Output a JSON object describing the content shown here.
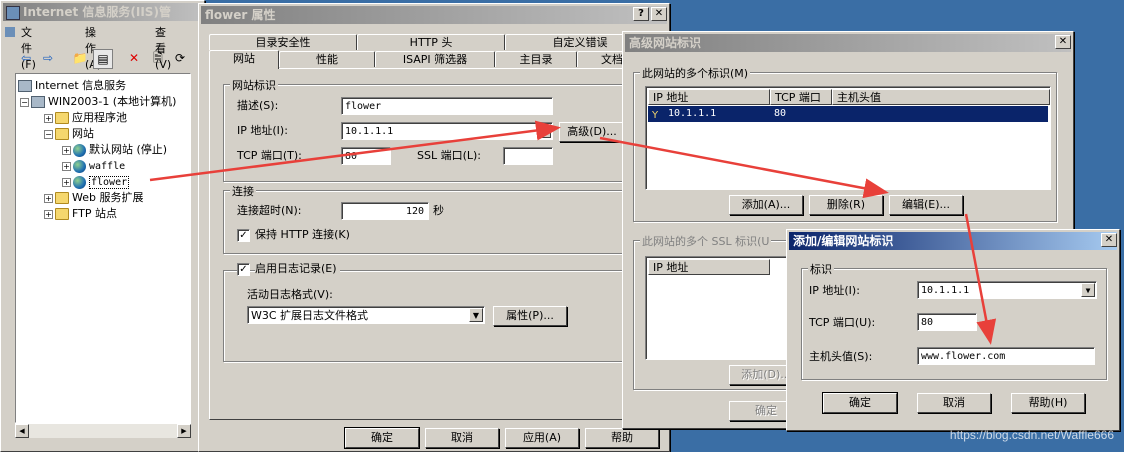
{
  "iis": {
    "title": "Internet 信息服务(IIS)管",
    "menu": [
      "文件(F)",
      "操作(A)",
      "查看(V)"
    ],
    "tree": [
      {
        "label": "Internet 信息服务",
        "icon": "iis-icon",
        "level": 0
      },
      {
        "label": "WIN2003-1 (本地计算机)",
        "icon": "computer-icon",
        "level": 1
      },
      {
        "label": "应用程序池",
        "icon": "folder-icon",
        "level": 2
      },
      {
        "label": "网站",
        "icon": "folder-icon",
        "level": 2
      },
      {
        "label": "默认网站 (停止)",
        "icon": "globe-icon",
        "level": 3
      },
      {
        "label": "waffle",
        "icon": "globe-icon",
        "level": 3
      },
      {
        "label": "flower",
        "icon": "globe-icon",
        "level": 3
      },
      {
        "label": "Web 服务扩展",
        "icon": "folder-icon",
        "level": 2
      },
      {
        "label": "FTP 站点",
        "icon": "folder-icon",
        "level": 2
      }
    ]
  },
  "props": {
    "title": "flower 属性",
    "tabs_row1": [
      "目录安全性",
      "HTTP 头",
      "自定义错误"
    ],
    "tabs_row2": [
      "网站",
      "性能",
      "ISAPI 筛选器",
      "主目录",
      "文档"
    ],
    "group_identity": "网站标识",
    "desc_label": "描述(S):",
    "desc_value": "flower",
    "ip_label": "IP 地址(I):",
    "ip_value": "10.1.1.1",
    "advanced_btn": "高级(D)...",
    "tcp_label": "TCP 端口(T):",
    "tcp_value": "80",
    "ssl_label": "SSL 端口(L):",
    "ssl_value": "",
    "group_conn": "连接",
    "timeout_label": "连接超时(N):",
    "timeout_value": "120",
    "timeout_unit": "秒",
    "keepalive_label": "保持 HTTP 连接(K)",
    "logging_label": "启用日志记录(E)",
    "log_format_label": "活动日志格式(V):",
    "log_format_value": "W3C 扩展日志文件格式",
    "log_props_btn": "属性(P)...",
    "ok": "确定",
    "cancel": "取消",
    "apply": "应用(A)",
    "help": "帮助"
  },
  "advanced": {
    "title": "高级网站标识",
    "group1": "此网站的多个标识(M)",
    "cols": [
      "IP 地址",
      "TCP 端口",
      "主机头值"
    ],
    "rows": [
      {
        "ip": "10.1.1.1",
        "port": "80",
        "host": ""
      }
    ],
    "add": "添加(A)...",
    "remove": "删除(R)",
    "edit": "编辑(E)...",
    "group2": "此网站的多个 SSL 标识(U",
    "ssl_col": "IP 地址",
    "add2": "添加(D)...",
    "ok": "确定"
  },
  "edit": {
    "title": "添加/编辑网站标识",
    "group": "标识",
    "ip_label": "IP 地址(I):",
    "ip_value": "10.1.1.1",
    "tcp_label": "TCP 端口(U):",
    "tcp_value": "80",
    "host_label": "主机头值(S):",
    "host_value": "www.flower.com",
    "ok": "确定",
    "cancel": "取消",
    "help": "帮助(H)"
  },
  "watermark": "https://blog.csdn.net/Waffle666",
  "colors": {
    "desktop": "#3a6ea5",
    "face": "#d4d0c8",
    "title_active": "#0a246a",
    "arrow": "#e8403a"
  }
}
